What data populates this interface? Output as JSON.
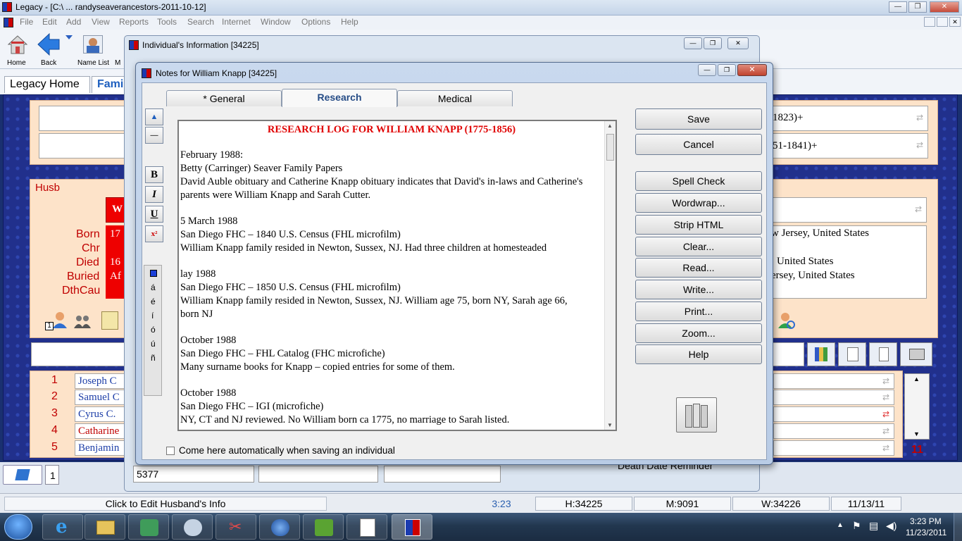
{
  "app": {
    "title": "Legacy - [C:\\ ... randyseaverancestors-2011-10-12]"
  },
  "menu": [
    "File",
    "Edit",
    "Add",
    "View",
    "Reports",
    "Tools",
    "Search",
    "Internet",
    "Window",
    "Options",
    "Help"
  ],
  "toolbar": {
    "home": "Home",
    "back": "Back",
    "namelist": "Name List",
    "m_trunc": "M"
  },
  "nav_tabs": {
    "legacy_home": "Legacy Home",
    "family": "Fami"
  },
  "family": {
    "husb_label": "Husb",
    "row1_right": "1823)+",
    "row2_right": "51-1841)+",
    "labels": {
      "born": "Born",
      "chr": "Chr",
      "died": "Died",
      "buried": "Buried",
      "dthcau": "DthCau"
    },
    "husb_name_trunc": "W",
    "born_val": "17",
    "died_val": "16",
    "buried_val": "Af",
    "wife_places": [
      "w Jersey, United States",
      "United States",
      "ersey, United States"
    ],
    "counter": "1",
    "children": [
      {
        "n": "1",
        "name": "Joseph C"
      },
      {
        "n": "2",
        "name": "Samuel C"
      },
      {
        "n": "3",
        "name": "Cyrus C."
      },
      {
        "n": "4",
        "name": "Catharine"
      },
      {
        "n": "5",
        "name": "Benjamin"
      }
    ],
    "child_count": "11",
    "bottom_left": "1",
    "bottom_id": "5377",
    "death_reminder": "Death Date Reminder"
  },
  "indiv_window": {
    "title": "Individual's Information  [34225]"
  },
  "notes_dialog": {
    "title": "Notes for William Knapp [34225]",
    "tabs": {
      "general": "* General",
      "research": "Research",
      "medical": "Medical"
    },
    "format": {
      "bold": "B",
      "italic": "I",
      "underline": "U",
      "superscript": "x²"
    },
    "accents": [
      "á",
      "é",
      "í",
      "ó",
      "ú",
      "ñ"
    ],
    "heading": "RESEARCH LOG FOR WILLIAM KNAPP (1775-1856)",
    "paragraphs": [
      [
        "February 1988:",
        "Betty (Carringer) Seaver Family Papers",
        "David Auble obituary and Catherine Knapp obituary indicates that David's in-laws and Catherine's",
        "parents were William Knapp and Sarah Cutter."
      ],
      [
        "5 March 1988",
        "San Diego FHC – 1840 U.S. Census (FHL microfilm)",
        "William Knapp family resided in Newton, Sussex, NJ.  Had three children at homesteaded"
      ],
      [
        "lay 1988",
        "San Diego FHC – 1850 U.S. Census (FHL microfilm)",
        "William Knapp family resided in Newton, Sussex, NJ.  William age 75, born NY, Sarah age 66,",
        "born NJ"
      ],
      [
        "October 1988",
        "San Diego  FHC – FHL Catalog (FHC microfiche)",
        "Many surname books for Knapp – copied entries for some of them."
      ],
      [
        "October 1988",
        "San Diego FHC – IGI (microfiche)",
        "NY, CT and NJ reviewed.  No William born ca 1775, no marriage to Sarah listed."
      ]
    ],
    "buttons": {
      "save": "Save",
      "cancel": "Cancel",
      "spell": "Spell Check",
      "wordwrap": "Wordwrap...",
      "strip": "Strip HTML",
      "clear": "Clear...",
      "read": "Read...",
      "write": "Write...",
      "print": "Print...",
      "zoom": "Zoom...",
      "help": "Help"
    },
    "auto_checkbox": "Come here automatically when saving an individual"
  },
  "status": {
    "hint": "Click to Edit Husband's Info",
    "time": "3:23",
    "h": "H:34225",
    "m": "M:9091",
    "w": "W:34226",
    "date": "11/13/11"
  },
  "taskbar": {
    "clock_time": "3:23 PM",
    "clock_date": "11/23/2011"
  },
  "colors": {
    "accent_red": "#c00000",
    "link_blue": "#1e3fa8",
    "family_bg": "#21308c",
    "peach": "#fde3c9"
  }
}
